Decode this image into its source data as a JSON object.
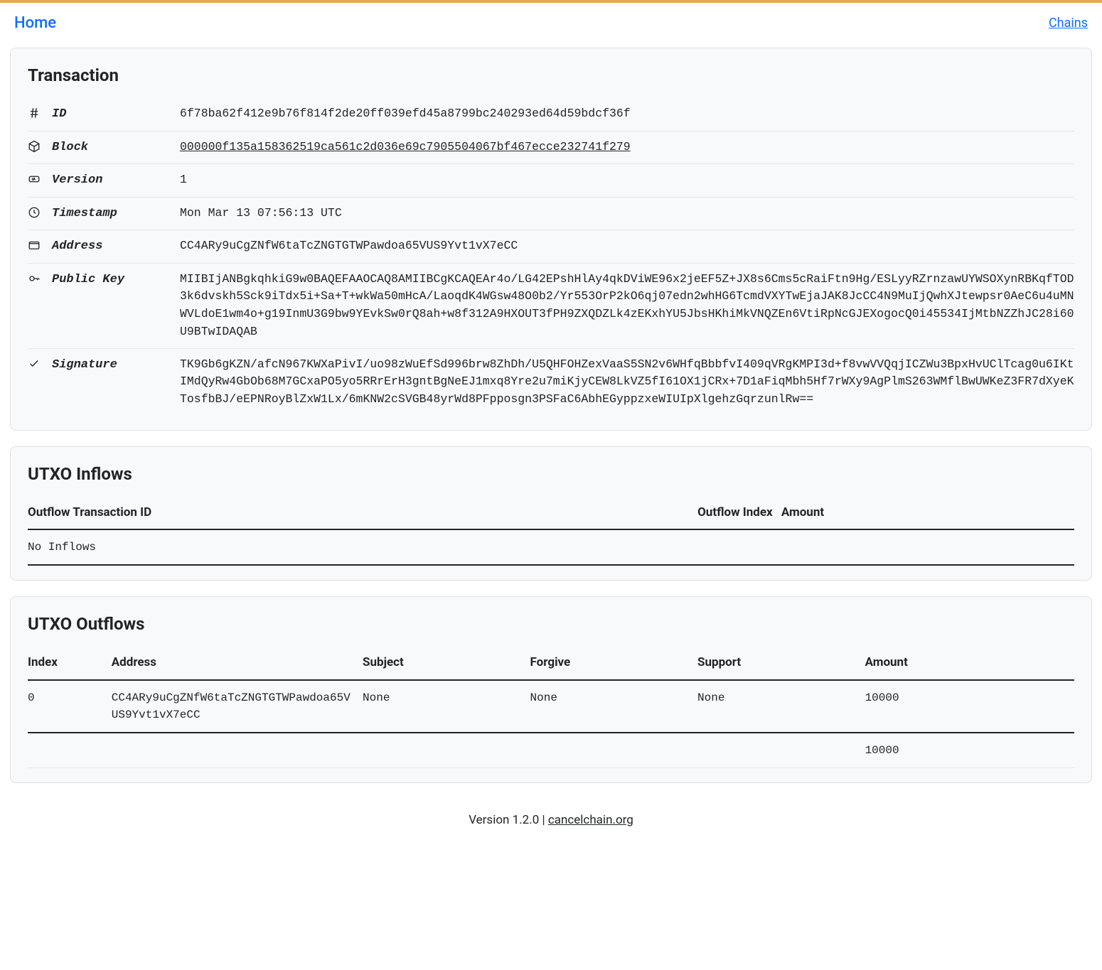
{
  "nav": {
    "home": "Home",
    "chains": "Chains"
  },
  "transaction": {
    "title": "Transaction",
    "labels": {
      "id": "ID",
      "block": "Block",
      "version": "Version",
      "timestamp": "Timestamp",
      "address": "Address",
      "public_key": "Public Key",
      "signature": "Signature"
    },
    "id": "6f78ba62f412e9b76f814f2de20ff039efd45a8799bc240293ed64d59bdcf36f",
    "block": "000000f135a158362519ca561c2d036e69c7905504067bf467ecce232741f279",
    "version": "1",
    "timestamp": "Mon Mar 13 07:56:13 UTC",
    "address": "CC4ARy9uCgZNfW6taTcZNGTGTWPawdoa65VUS9Yvt1vX7eCC",
    "public_key": "MIIBIjANBgkqhkiG9w0BAQEFAAOCAQ8AMIIBCgKCAQEAr4o/LG42EPshHlAy4qkDViWE96x2jeEF5Z+JX8s6Cms5cRaiFtn9Hg/ESLyyRZrnzawUYWSOXynRBKqfTOD3k6dvskh5Sck9iTdx5i+Sa+T+wkWa50mHcA/LaoqdK4WGsw48O0b2/Yr553OrP2kO6qj07edn2whHG6TcmdVXYTwEjaJAK8JcCC4N9MuIjQwhXJtewpsr0AeC6u4uMNWVLdoE1wm4o+g19InmU3G9bw9YEvkSw0rQ8ah+w8f312A9HXOUT3fPH9ZXQDZLk4zEKxhYU5JbsHKhiMkVNQZEn6VtiRpNcGJEXogocQ0i45534IjMtbNZZhJC28i60U9BTwIDAQAB",
    "signature": "TK9Gb6gKZN/afcN967KWXaPivI/uo98zWuEfSd996brw8ZhDh/U5QHFOHZexVaaS5SN2v6WHfqBbbfvI409qVRgKMPI3d+f8vwVVQqjICZWu3BpxHvUClTcag0u6IKtIMdQyRw4GbOb68M7GCxaPO5yo5RRrErH3gntBgNeEJ1mxq8Yre2u7miKjyCEW8LkVZ5fI61OX1jCRx+7D1aFiqMbh5Hf7rWXy9AgPlmS263WMflBwUWKeZ3FR7dXyeKTosfbBJ/eEPNRoyBlZxW1Lx/6mKNW2cSVGB48yrWd8PFpposgn3PSFaC6AbhEGyppzxeWIUIpXlgehzGqrzunlRw=="
  },
  "inflows": {
    "title": "UTXO Inflows",
    "headers": {
      "outflow_tx_id": "Outflow Transaction ID",
      "outflow_index": "Outflow Index",
      "amount": "Amount"
    },
    "empty": "No Inflows"
  },
  "outflows": {
    "title": "UTXO Outflows",
    "headers": {
      "index": "Index",
      "address": "Address",
      "subject": "Subject",
      "forgive": "Forgive",
      "support": "Support",
      "amount": "Amount"
    },
    "rows": [
      {
        "index": "0",
        "address": "CC4ARy9uCgZNfW6taTcZNGTGTWPawdoa65VUS9Yvt1vX7eCC",
        "subject": "None",
        "forgive": "None",
        "support": "None",
        "amount": "10000"
      }
    ],
    "total": "10000"
  },
  "footer": {
    "version_prefix": "Version 1.2.0 | ",
    "link": "cancelchain.org"
  }
}
